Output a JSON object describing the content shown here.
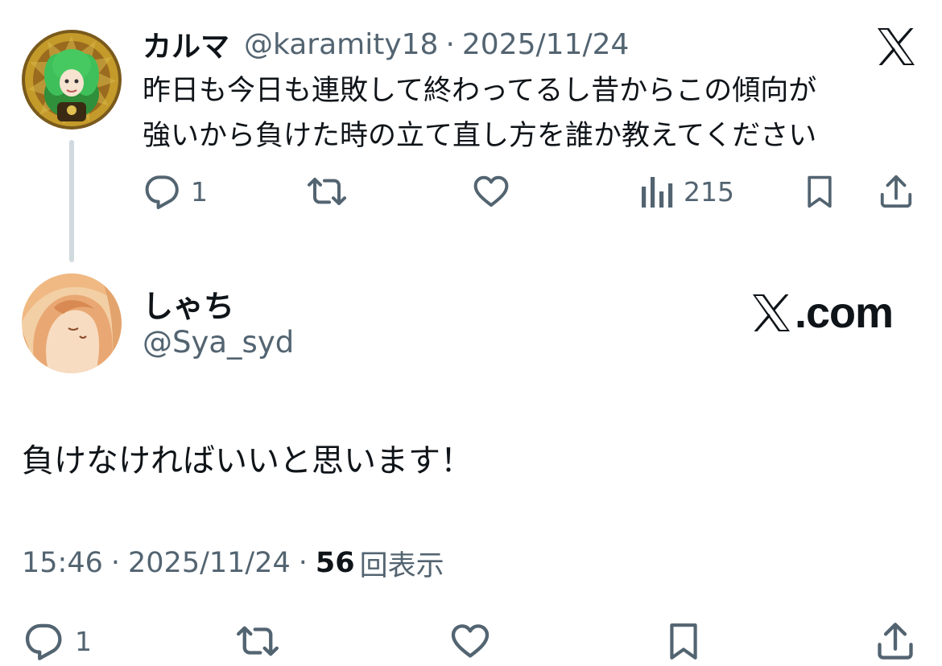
{
  "quoted_tweet": {
    "display_name": "カルマ",
    "handle": "@karamity18",
    "separator": "·",
    "date": "2025/11/24",
    "text_lines": [
      "昨日も今日も連敗して終わってるし昔からこの傾向が",
      "強いから負けた時の立て直し方を誰か教えてください"
    ],
    "replies": "1",
    "views": "215"
  },
  "reply_tweet": {
    "display_name": "しゃち",
    "handle": "@Sya_syd",
    "brand": ".com",
    "text": "負けなければいいと思います！",
    "time": "15:46",
    "separator": "·",
    "date": "2025/11/24",
    "views_count": "56",
    "views_label": "回表示",
    "replies": "1"
  },
  "icons": [
    "reply-icon",
    "retweet-icon",
    "like-icon",
    "views-icon",
    "bookmark-icon",
    "share-icon",
    "x-logo-icon"
  ],
  "colors": {
    "text": "#0f1419",
    "secondary": "#536471",
    "thread_line": "#cfd9de",
    "background": "#ffffff"
  }
}
